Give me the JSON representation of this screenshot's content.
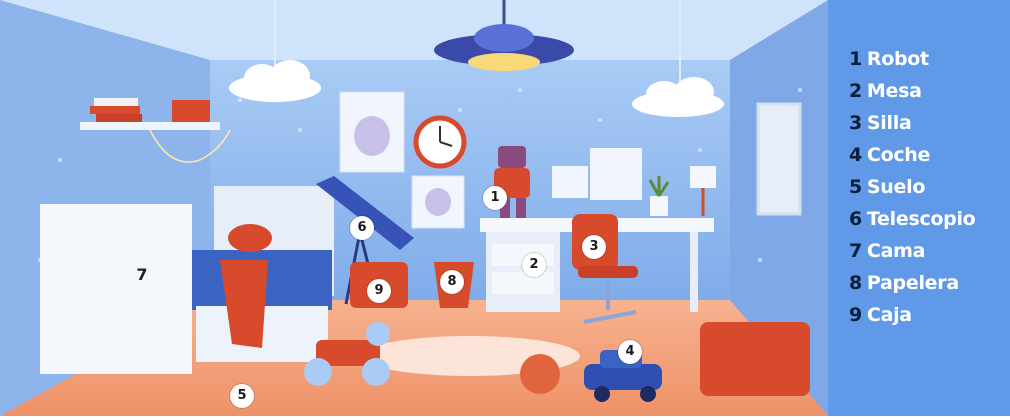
{
  "legend": {
    "items": [
      {
        "number": "1",
        "label": "Robot"
      },
      {
        "number": "2",
        "label": "Mesa"
      },
      {
        "number": "3",
        "label": "Silla"
      },
      {
        "number": "4",
        "label": "Coche"
      },
      {
        "number": "5",
        "label": "Suelo"
      },
      {
        "number": "6",
        "label": "Telescopio"
      },
      {
        "number": "7",
        "label": "Cama"
      },
      {
        "number": "8",
        "label": "Papelera"
      },
      {
        "number": "9",
        "label": "Caja"
      }
    ]
  },
  "markers": {
    "robot": "1",
    "mesa": "2",
    "silla": "3",
    "coche": "4",
    "suelo": "5",
    "telescopio": "6",
    "cama": "7",
    "papelera": "8",
    "caja": "9"
  },
  "colors": {
    "legend_bg": "#5f99e8",
    "wall": "#8fb8ee",
    "floor": "#f2a27e",
    "furniture_red": "#d84a2c",
    "white_furniture": "#f4f7fc"
  }
}
